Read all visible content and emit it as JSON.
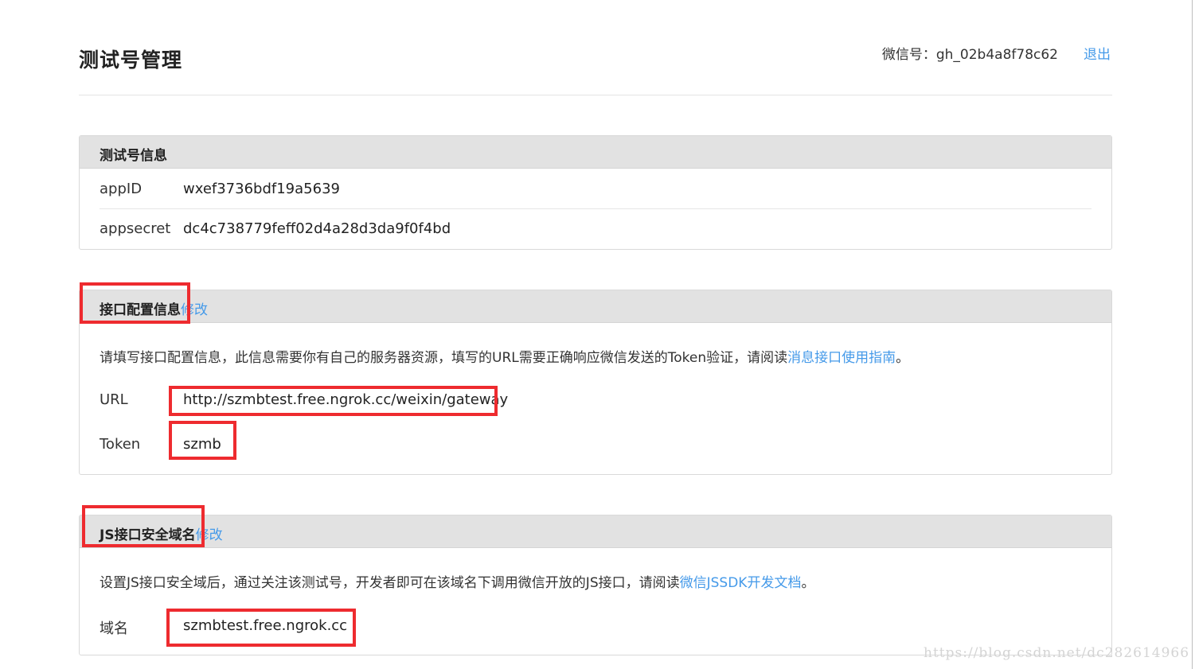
{
  "header": {
    "title": "测试号管理",
    "account_label": "微信号：",
    "account_id": "gh_02b4a8f78c62",
    "logout": "退出"
  },
  "info_panel": {
    "title": "测试号信息",
    "rows": [
      {
        "key": "appID",
        "value": "wxef3736bdf19a5639"
      },
      {
        "key": "appsecret",
        "value": "dc4c738779feff02d4a28d3da9f0f4bd"
      }
    ]
  },
  "interface_panel": {
    "title": "接口配置信息",
    "edit": "修改",
    "desc_text": "请填写接口配置信息，此信息需要你有自己的服务器资源，填写的URL需要正确响应微信发送的Token验证，请阅读",
    "desc_link": "消息接口使用指南",
    "desc_end": "。",
    "url_label": "URL",
    "url_value": "http://szmbtest.free.ngrok.cc/weixin/gateway",
    "token_label": "Token",
    "token_value": "szmb"
  },
  "js_panel": {
    "title": "JS接口安全域名",
    "edit": "修改",
    "desc_text": "设置JS接口安全域后，通过关注该测试号，开发者即可在该域名下调用微信开放的JS接口，请阅读",
    "desc_link": "微信JSSDK开发文档",
    "desc_end": "。",
    "domain_label": "域名",
    "domain_value": "szmbtest.free.ngrok.cc"
  },
  "watermark": "https://blog.csdn.net/dc282614966",
  "colors": {
    "link": "#459ae9",
    "highlight": "#ee2b2f",
    "panel_header": "#e2e2e2"
  }
}
